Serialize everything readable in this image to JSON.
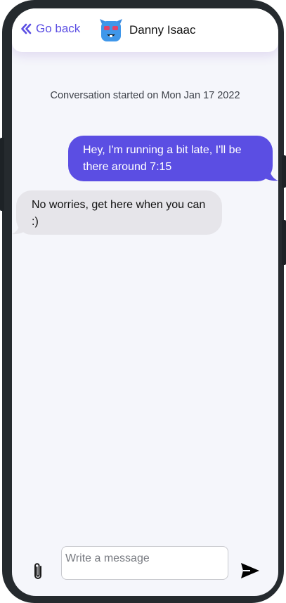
{
  "header": {
    "back_label": "Go back",
    "contact_name": "Danny Isaac"
  },
  "conversation": {
    "started_text": "Conversation started on Mon Jan 17 2022",
    "messages": [
      {
        "direction": "sent",
        "text": "Hey, I'm running a bit late, I'll be there around 7:15"
      },
      {
        "direction": "received",
        "text": "No worries, get here when you can :)"
      }
    ]
  },
  "composer": {
    "placeholder": "Write a message",
    "value": ""
  },
  "icons": {
    "back": "double-chevron-left-icon",
    "attach": "paperclip-icon",
    "send": "send-icon",
    "avatar": "robot-avatar"
  },
  "colors": {
    "accent": "#5b4ee3",
    "sent_bubble": "#5b4ee3",
    "received_bubble": "#e6e5ea",
    "background": "#f5f6fb"
  }
}
